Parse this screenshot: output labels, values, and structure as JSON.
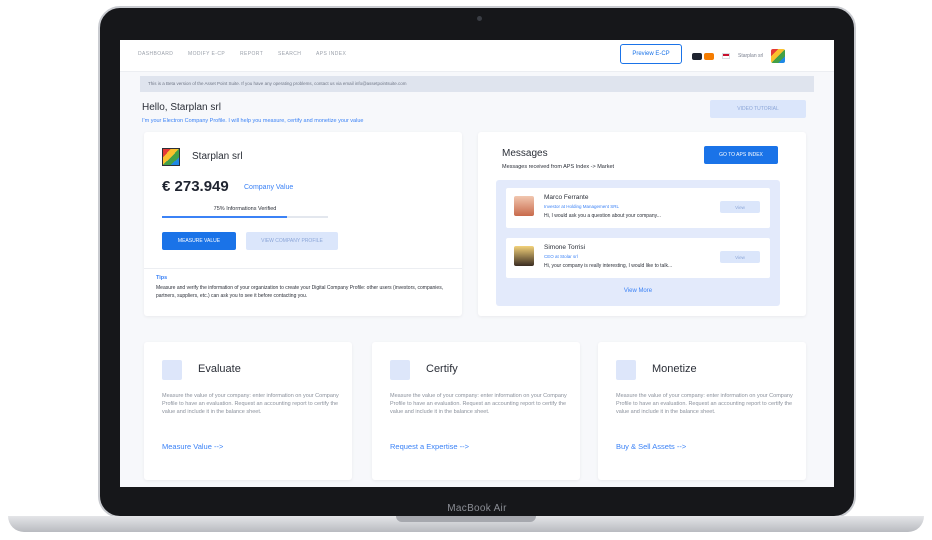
{
  "device": {
    "label": "MacBook Air"
  },
  "nav": {
    "items": [
      "DASHBOARD",
      "MODIFY E-CP",
      "REPORT",
      "SEARCH",
      "APS INDEX"
    ],
    "preview_button": "Preview E-CP",
    "user_name": "Starplan srl"
  },
  "beta_notice": "This is a Beta version of the Asset Point Suite. If you have any operating problems, contact us via email info@assetpointsuite.com",
  "greeting": {
    "title": "Hello, Starplan srl",
    "subtitle": "I'm your Electron Company Profile. I will help you measure, certify and monetize your value",
    "video_button": "VIDEO TUTORIAL"
  },
  "company": {
    "name": "Starplan srl",
    "value": "€ 273.949",
    "value_label": "Company Value",
    "verified_label": "75% Informations Verified",
    "verified_fraction": 0.75,
    "measure_button": "MEASURE VALUE",
    "view_profile_button": "VIEW COMPANY PROFILE",
    "tips_title": "Tips",
    "tips_text": "Measure and verify the information of your organization to create your Digital Company Profile: other users (investors, companies, partners, suppliers, etc.) can ask you to see it before contacting you."
  },
  "messages": {
    "title": "Messages",
    "subtitle": "Messages received from APS Index -> Market",
    "go_button": "GO TO APS INDEX",
    "items": [
      {
        "name": "Marco Ferrante",
        "role": "Investor at Holding Management SRL",
        "text": "Hi, I would ask you a question about your company...",
        "view": "View"
      },
      {
        "name": "Simone Torrisi",
        "role": "CEO at Stolar srl",
        "text": "Hi, your company is really interesting, I would like to talk...",
        "view": "View"
      }
    ],
    "view_more": "View More"
  },
  "features": [
    {
      "title": "Evaluate",
      "text": "Measure the value of your company: enter information on your Company Profile to have an evaluation. Request an accounting report to certify the value and include it in the balance sheet.",
      "link": "Measure Value -->"
    },
    {
      "title": "Certify",
      "text": "Measure the value of your company: enter information on your Company Profile to have an evaluation. Request an accounting report to certify the value and include it in the balance sheet.",
      "link": "Request a Expertise -->"
    },
    {
      "title": "Monetize",
      "text": "Measure the value of your company: enter information on your Company Profile to have an evaluation. Request an accounting report to certify the value and include it in the balance sheet.",
      "link": "Buy & Sell Assets -->"
    }
  ],
  "colors": {
    "accent": "#1a73e8",
    "link": "#3b82f6",
    "soft": "#dbe6fb"
  },
  "icons": [
    "avatar-marco-icon",
    "avatar-simone-icon",
    "notification-icon",
    "wallet-icon",
    "flag-icon",
    "company-logo-icon"
  ]
}
